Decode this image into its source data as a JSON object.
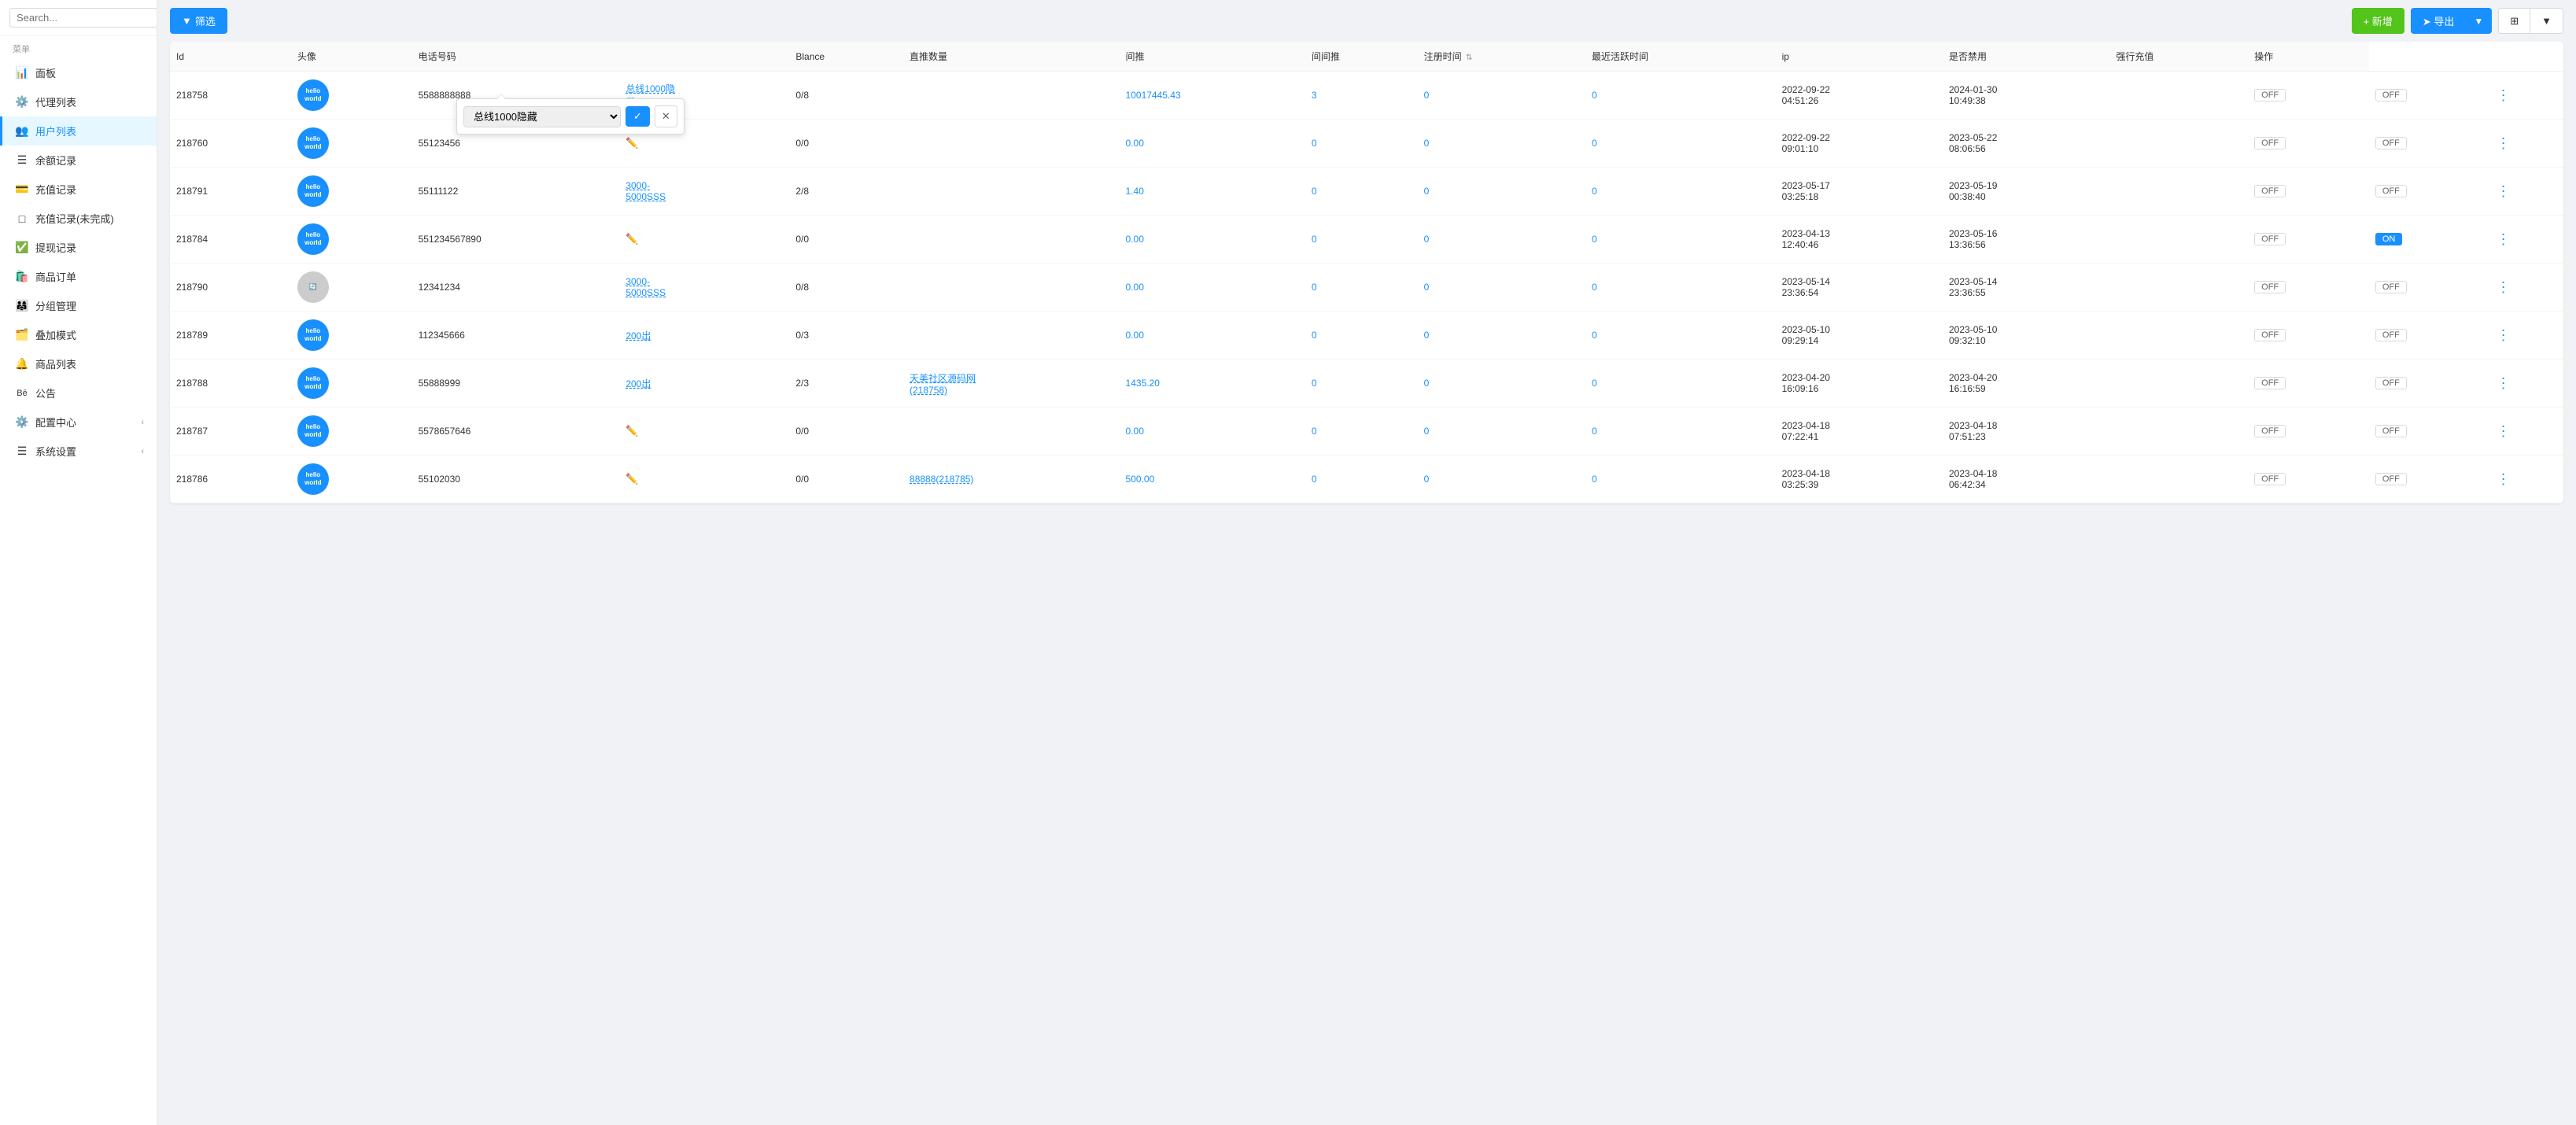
{
  "sidebar": {
    "search_placeholder": "Search...",
    "menu_label": "菜单",
    "items": [
      {
        "id": "dashboard",
        "icon": "📊",
        "label": "面板",
        "active": false
      },
      {
        "id": "agent-list",
        "icon": "⚙️",
        "label": "代理列表",
        "active": false
      },
      {
        "id": "user-list",
        "icon": "👥",
        "label": "用户列表",
        "active": true
      },
      {
        "id": "balance-record",
        "icon": "☰",
        "label": "余额记录",
        "active": false
      },
      {
        "id": "recharge-record",
        "icon": "💳",
        "label": "充值记录",
        "active": false
      },
      {
        "id": "recharge-incomplete",
        "icon": "□",
        "label": "充值记录(未完成)",
        "active": false
      },
      {
        "id": "withdrawal-record",
        "icon": "✅",
        "label": "提现记录",
        "active": false
      },
      {
        "id": "product-order",
        "icon": "🛍️",
        "label": "商品订单",
        "active": false
      },
      {
        "id": "group-management",
        "icon": "👨‍👩‍👧",
        "label": "分组管理",
        "active": false
      },
      {
        "id": "stack-mode",
        "icon": "🗂️",
        "label": "叠加模式",
        "active": false
      },
      {
        "id": "product-list",
        "icon": "🔔",
        "label": "商品列表",
        "active": false
      },
      {
        "id": "announcement",
        "icon": "Bē",
        "label": "公告",
        "active": false
      },
      {
        "id": "config-center",
        "icon": "⚙️",
        "label": "配置中心",
        "active": false,
        "arrow": "‹"
      },
      {
        "id": "system-settings",
        "icon": "☰",
        "label": "系统设置",
        "active": false,
        "arrow": "‹"
      }
    ]
  },
  "toolbar": {
    "filter_label": "筛选",
    "add_label": "+ 新增",
    "export_label": "➤ 导出",
    "export_arrow": "▼",
    "table_icon": "⊞",
    "table_arrow": "▼"
  },
  "dropdown": {
    "options": [
      "总线1000隐藏"
    ],
    "selected": "总线1000隐藏"
  },
  "table": {
    "columns": [
      "Id",
      "头像",
      "电话号码",
      "",
      "Blance",
      "直推数量",
      "间推",
      "间间推",
      "注册时间",
      "最近活跃时间",
      "ip",
      "是否禁用",
      "强行充值",
      "操作"
    ],
    "rows": [
      {
        "id": "218758",
        "avatar_text": "hello\nworld",
        "avatar_color": "#1890ff",
        "phone": "5588888888",
        "line": "总线1000隐藏",
        "ratio": "0/8",
        "ref": "",
        "balance": "10017445.43",
        "direct": "3",
        "indirect": "0",
        "indirect2": "0",
        "reg_time": "2022-09-22 04:51:26",
        "active_time": "2024-01-30 10:49:38",
        "ip": "",
        "disabled": "OFF",
        "force_charge": "OFF"
      },
      {
        "id": "218760",
        "avatar_text": "hello\nworld",
        "avatar_color": "#1890ff",
        "phone": "55123456",
        "line": "",
        "ratio": "0/0",
        "ref": "",
        "balance": "0.00",
        "direct": "0",
        "indirect": "0",
        "indirect2": "0",
        "reg_time": "2022-09-22 09:01:10",
        "active_time": "2023-05-22 08:06:56",
        "ip": "",
        "disabled": "OFF",
        "force_charge": "OFF"
      },
      {
        "id": "218791",
        "avatar_text": "hello\nworld",
        "avatar_color": "#1890ff",
        "phone": "55111122",
        "line": "3000-5000SSS",
        "ratio": "2/8",
        "ref": "",
        "balance": "1.40",
        "direct": "0",
        "indirect": "0",
        "indirect2": "0",
        "reg_time": "2023-05-17 03:25:18",
        "active_time": "2023-05-19 00:38:40",
        "ip": "",
        "disabled": "OFF",
        "force_charge": "OFF"
      },
      {
        "id": "218784",
        "avatar_text": "hello\nworld",
        "avatar_color": "#1890ff",
        "phone": "551234567890",
        "line": "",
        "ratio": "0/0",
        "ref": "",
        "balance": "0.00",
        "direct": "0",
        "indirect": "0",
        "indirect2": "0",
        "reg_time": "2023-04-13 12:40:46",
        "active_time": "2023-05-16 13:36:56",
        "ip": "",
        "disabled": "OFF",
        "force_charge": "ON"
      },
      {
        "id": "218790",
        "avatar_text": "",
        "avatar_color": "#ccc",
        "phone": "12341234",
        "line": "3000-5000SSS",
        "ratio": "0/8",
        "ref": "",
        "balance": "0.00",
        "direct": "0",
        "indirect": "0",
        "indirect2": "0",
        "reg_time": "2023-05-14 23:36:54",
        "active_time": "2023-05-14 23:36:55",
        "ip": "",
        "disabled": "OFF",
        "force_charge": "OFF"
      },
      {
        "id": "218789",
        "avatar_text": "hello\nworld",
        "avatar_color": "#1890ff",
        "phone": "112345666",
        "line": "200出",
        "ratio": "0/3",
        "ref": "",
        "balance": "0.00",
        "direct": "0",
        "indirect": "0",
        "indirect2": "0",
        "reg_time": "2023-05-10 09:29:14",
        "active_time": "2023-05-10 09:32:10",
        "ip": "",
        "disabled": "OFF",
        "force_charge": "OFF"
      },
      {
        "id": "218788",
        "avatar_text": "hello\nworld",
        "avatar_color": "#1890ff",
        "phone": "55888999",
        "line": "200出",
        "ratio": "2/3",
        "ref": "天美社区源码网(218758)",
        "balance": "1435.20",
        "direct": "0",
        "indirect": "0",
        "indirect2": "0",
        "reg_time": "2023-04-20 16:09:16",
        "active_time": "2023-04-20 16:16:59",
        "ip": "",
        "disabled": "OFF",
        "force_charge": "OFF"
      },
      {
        "id": "218787",
        "avatar_text": "hello\nworld",
        "avatar_color": "#1890ff",
        "phone": "5578657646",
        "line": "",
        "ratio": "0/0",
        "ref": "",
        "balance": "0.00",
        "direct": "0",
        "indirect": "0",
        "indirect2": "0",
        "reg_time": "2023-04-18 07:22:41",
        "active_time": "2023-04-18 07:51:23",
        "ip": "",
        "disabled": "OFF",
        "force_charge": "OFF"
      },
      {
        "id": "218786",
        "avatar_text": "hello\nworld",
        "avatar_color": "#1890ff",
        "phone": "55102030",
        "line": "",
        "ratio": "0/0",
        "ref": "88888(218785)",
        "balance": "500.00",
        "direct": "0",
        "indirect": "0",
        "indirect2": "0",
        "reg_time": "2023-04-18 03:25:39",
        "active_time": "2023-04-18 06:42:34",
        "ip": "",
        "disabled": "OFF",
        "force_charge": "OFF"
      }
    ]
  }
}
